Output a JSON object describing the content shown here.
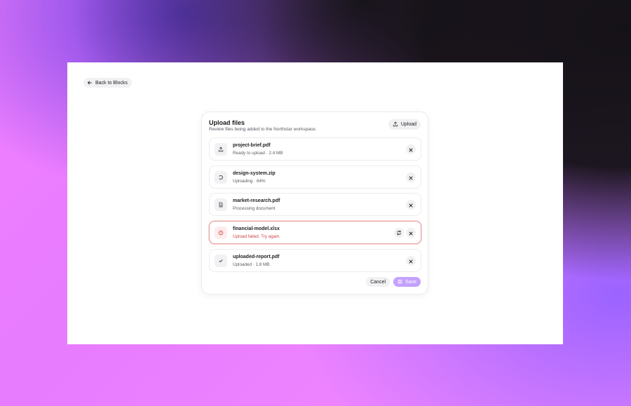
{
  "back_button": {
    "label": "Back to Blocks",
    "icon": "arrow-left-icon"
  },
  "card": {
    "title": "Upload files",
    "subtitle": "Review files being added to the Northstar workspace.",
    "upload_label": "Upload",
    "upload_icon": "upload-icon"
  },
  "files": [
    {
      "name": "project-brief.pdf",
      "status": "Ready to upload · 2.4 MB",
      "state": "ready",
      "icon": "upload-icon"
    },
    {
      "name": "design-system.zip",
      "status": "Uploading · 64%",
      "state": "uploading",
      "progress": 0.64,
      "icon": "spinner-icon"
    },
    {
      "name": "market-research.pdf",
      "status": "Processing document",
      "state": "processing",
      "icon": "document-icon"
    },
    {
      "name": "financial-model.xlsx",
      "status": "Upload failed. Try again.",
      "state": "error",
      "icon": "alert-circle-icon"
    },
    {
      "name": "uploaded-report.pdf",
      "status": "Uploaded · 1.8 MB",
      "state": "done",
      "icon": "check-icon"
    }
  ],
  "footer": {
    "cancel_label": "Cancel",
    "save_label": "Save",
    "save_icon": "save-icon"
  },
  "colors": {
    "accent": "#c3a1ff",
    "error": "#d04545",
    "error_border": "#eaa2a2"
  }
}
